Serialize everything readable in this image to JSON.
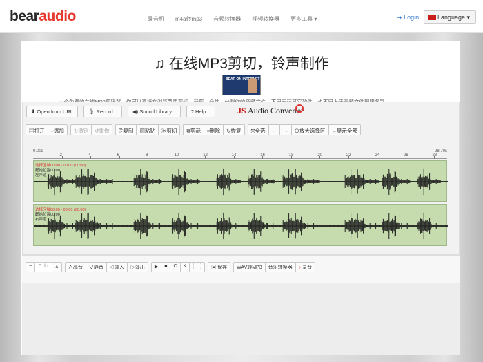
{
  "nav": {
    "logo_main": "bear",
    "logo_accent": "audio",
    "links": [
      "录音机",
      "m4a转mp3",
      "音频转换器",
      "视频转换器",
      "更多工具 ▾"
    ],
    "login": "Login",
    "language": "Language ▾"
  },
  "page": {
    "title": "在线MP3剪切，铃声制作",
    "thumb_text": "BEAR ON INTERNET",
    "subtitle": "一个免费的在线MP3剪辑器，你可以直接在浏览器里剪切、裁剪、合并、分割你的音频文件。不用安装其它软件，也不用上传音频文件到服务器。"
  },
  "toolbar1": {
    "open_url": "Open from URL",
    "record": "Record...",
    "sound_library": "Sound Library...",
    "help": "Help...",
    "js_brand": "JS",
    "converter": "Audio Converter"
  },
  "toolbar2": {
    "groups": [
      [
        {
          "icon": "folder-icon",
          "label": "打开",
          "g": "▤"
        },
        {
          "icon": "add-icon",
          "label": "添加",
          "g": "+"
        }
      ],
      [
        {
          "icon": "redo-icon",
          "label": "撤销",
          "g": "↻",
          "disabled": true
        },
        {
          "icon": "undo-icon",
          "label": "重做",
          "g": "↺",
          "disabled": true
        }
      ],
      [
        {
          "icon": "copy-icon",
          "label": "复制",
          "g": "⎘"
        },
        {
          "icon": "paste-icon",
          "label": "粘贴",
          "g": "▨"
        },
        {
          "icon": "cut-icon",
          "label": "剪切",
          "g": "✂"
        }
      ],
      [
        {
          "icon": "trim-icon",
          "label": "剪裁",
          "g": "⧉"
        },
        {
          "icon": "delete-icon",
          "label": "删除",
          "g": "×"
        },
        {
          "icon": "restore-icon",
          "label": "恢复",
          "g": "↻"
        }
      ],
      [
        {
          "icon": "select-all-icon",
          "label": "全选",
          "g": "⤧"
        },
        {
          "icon": "arrow-left-icon",
          "label": "",
          "g": "←"
        },
        {
          "icon": "arrow-right-icon",
          "label": "",
          "g": "→"
        },
        {
          "icon": "zoom-icon",
          "label": "放大选择区",
          "g": "⊕"
        },
        {
          "icon": "show-all-icon",
          "label": "显示全部",
          "g": "↔"
        }
      ]
    ]
  },
  "timeline": {
    "start": "0.00s",
    "end": "28.70s",
    "ticks": [
      "2",
      "4",
      "6",
      "8",
      "10",
      "12",
      "14",
      "16",
      "18",
      "20",
      "22",
      "24",
      "26",
      "28"
    ]
  },
  "tracks": [
    {
      "selection": "选择区域00:00 - 00:00 (00:00)",
      "start_label": "起始位置00:00",
      "lane": "左声道"
    },
    {
      "selection": "选择区域00:00 - 00:00 (00:00)",
      "start_label": "起始位置00:00",
      "lane": "右声道"
    }
  ],
  "controls": {
    "volume": "0 db",
    "effects": [
      "∧高音",
      "∨静音",
      "◁淡入",
      "▷淡出"
    ],
    "transport": [
      "▶",
      "■",
      "C",
      "K",
      "[",
      "]"
    ],
    "save": "保存",
    "wav_mp3": "WAV转MP3",
    "music_converter": "音乐转换器",
    "record": "录音"
  },
  "colors": {
    "accent": "#e8392f",
    "track_bg": "#c6dcae",
    "wave": "#1f1f1f"
  }
}
